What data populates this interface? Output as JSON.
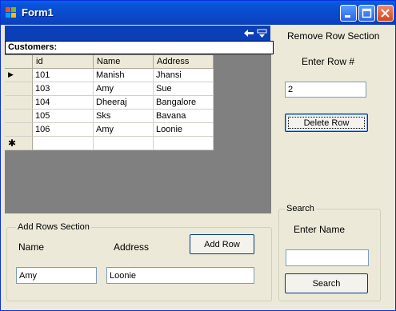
{
  "window": {
    "title": "Form1",
    "icon": "windows-app-icon",
    "controls": [
      "minimize-icon",
      "maximize-icon",
      "close-icon"
    ]
  },
  "binding_navigator": {
    "icons": [
      "back-arrow-icon",
      "collapse-icon"
    ]
  },
  "grid": {
    "caption": "Customers:",
    "columns": [
      "id",
      "Name",
      "Address"
    ],
    "rows": [
      [
        "101",
        "Manish",
        "Jhansi"
      ],
      [
        "103",
        "Amy",
        "Sue"
      ],
      [
        "104",
        "Dheeraj",
        "Bangalore"
      ],
      [
        "105",
        "Sks",
        "Bavana"
      ],
      [
        "106",
        "Amy",
        "Loonie"
      ]
    ],
    "current_row_indicator": "▶",
    "new_row_indicator": "✱"
  },
  "remove_section": {
    "title": "Remove Row Section",
    "row_label": "Enter Row #",
    "row_value": "2",
    "delete_label": "Delete Row"
  },
  "add_section": {
    "legend": "Add Rows Section",
    "name_label": "Name",
    "address_label": "Address",
    "add_label": "Add Row",
    "name_value": "Amy",
    "address_value": "Loonie"
  },
  "search_section": {
    "legend": "Search",
    "name_label": "Enter Name",
    "name_value": "",
    "search_label": "Search"
  },
  "colors": {
    "title_bar": "#0a46c6",
    "form_background": "#ece9d8",
    "grid_background": "#808080",
    "button_border": "#003c74"
  }
}
